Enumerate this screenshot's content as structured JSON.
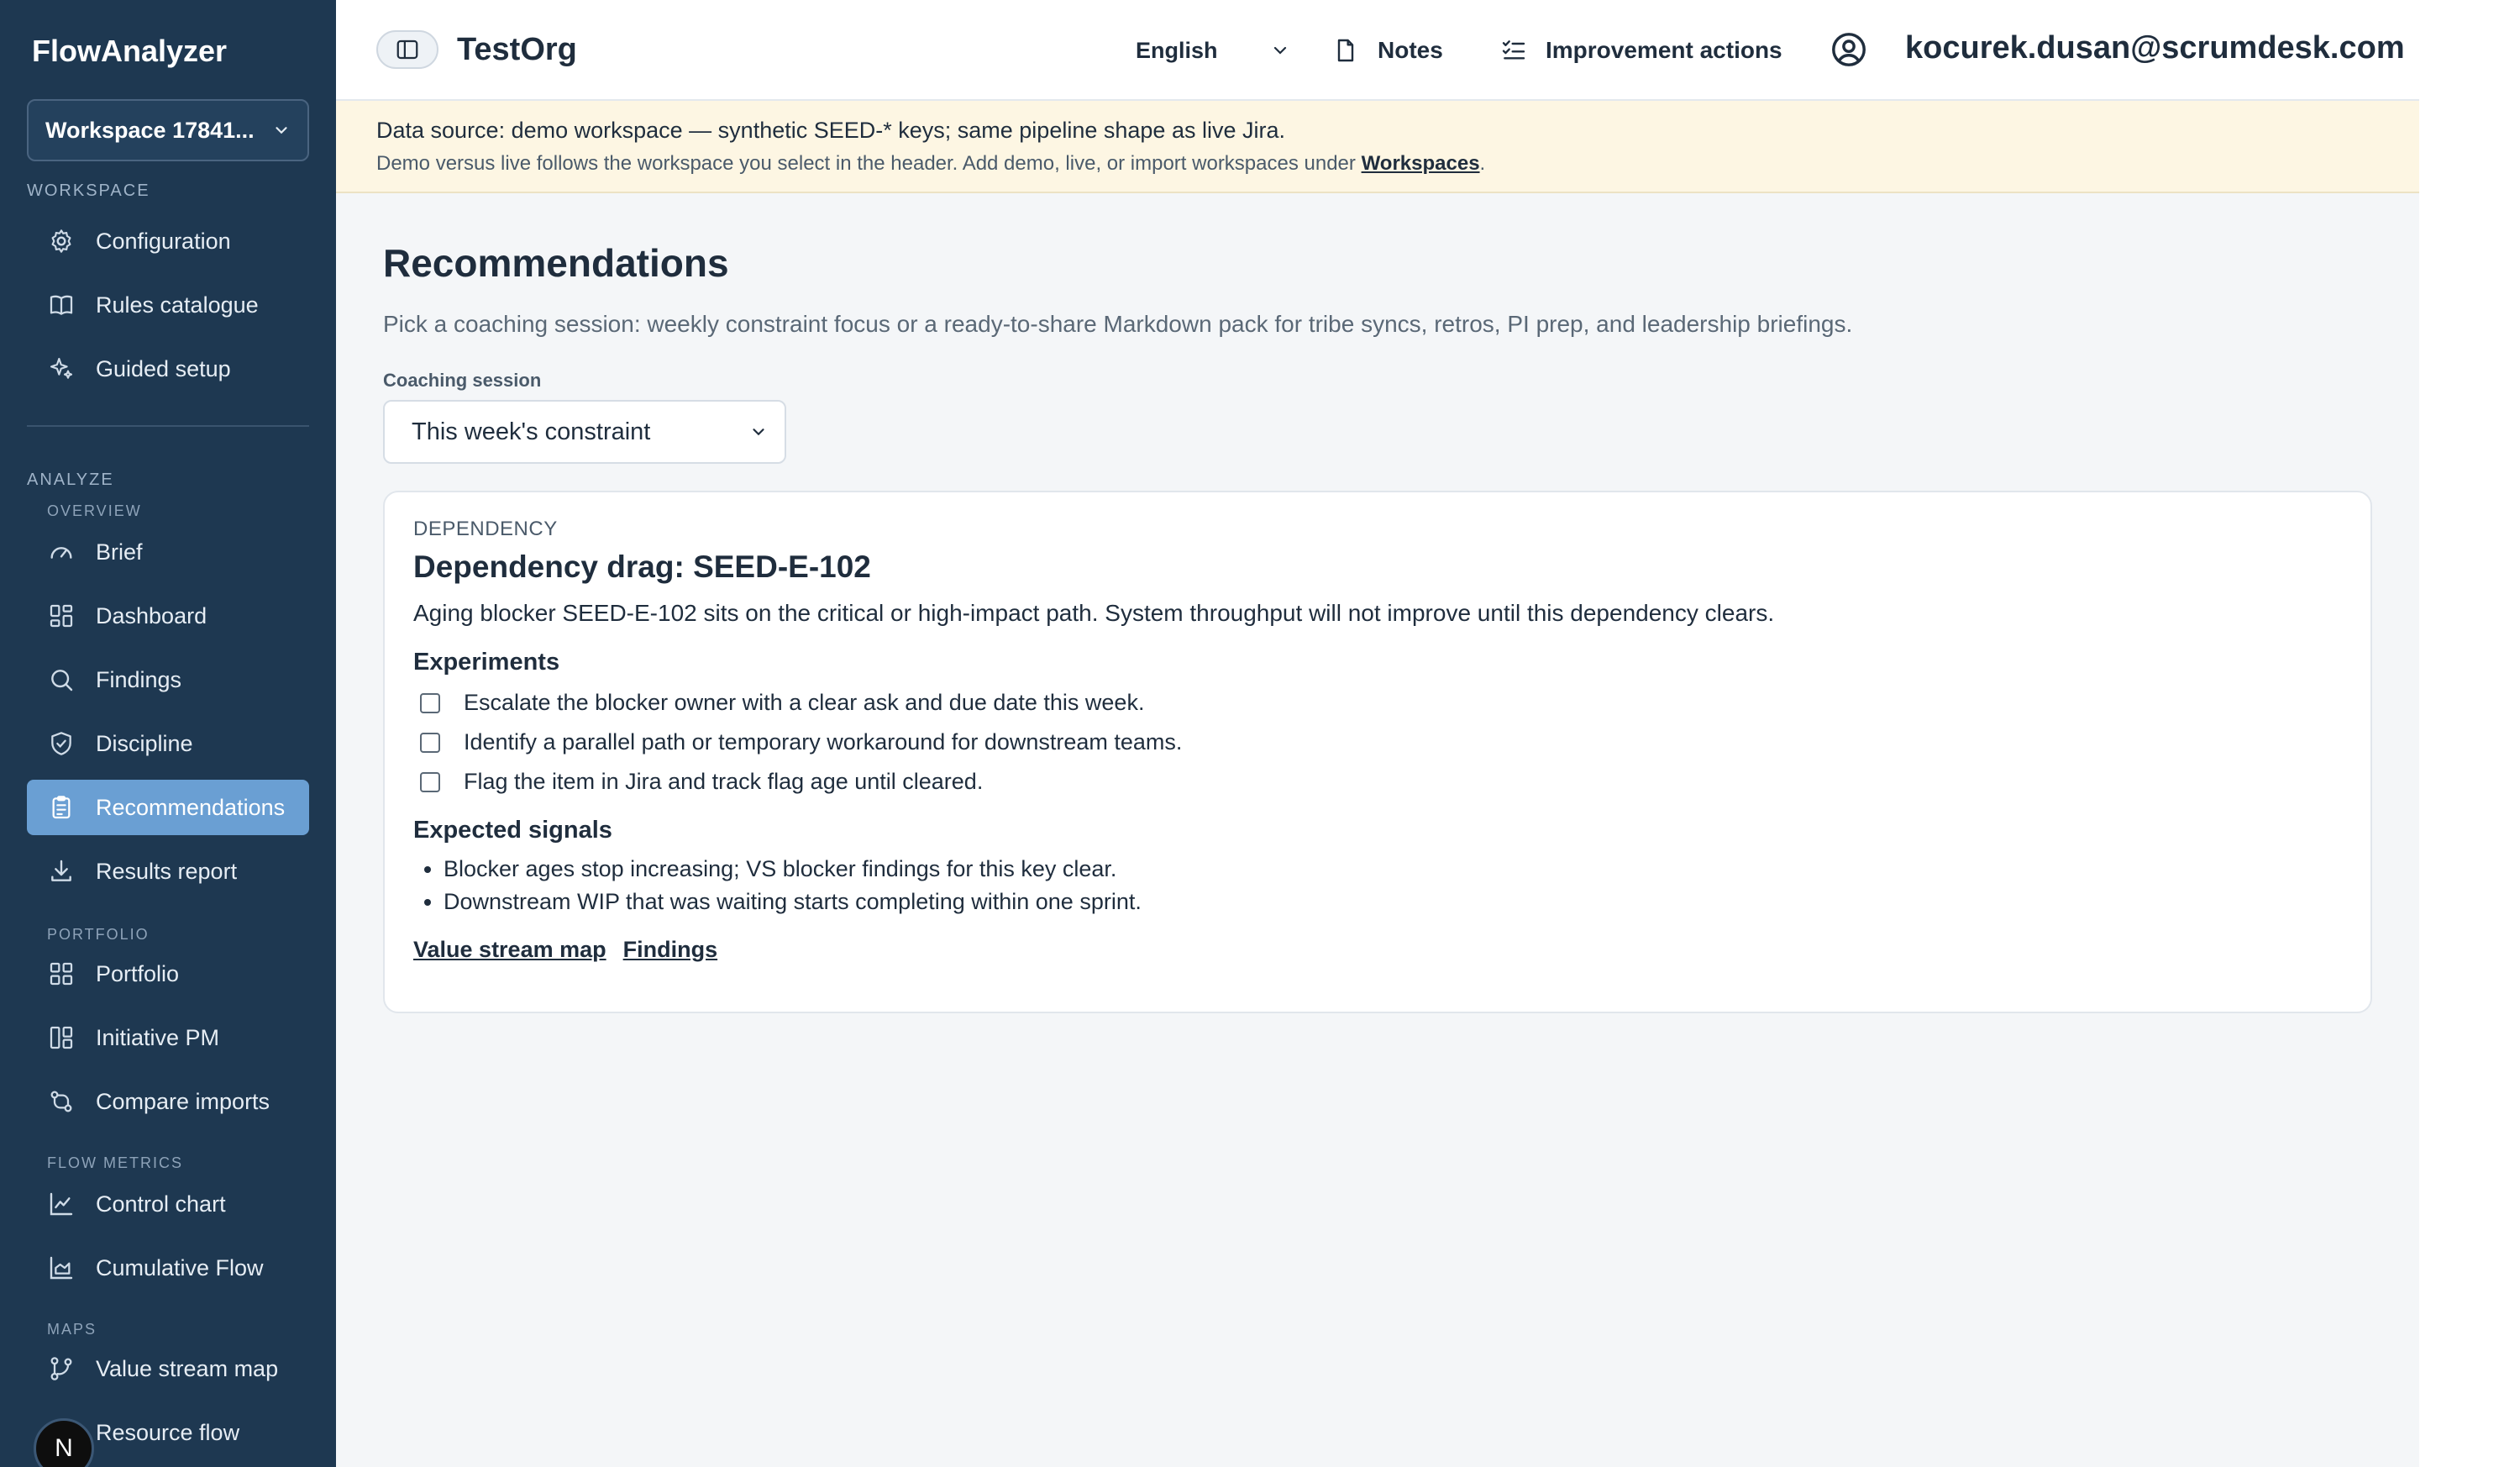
{
  "app": {
    "brand": "FlowAnalyzer"
  },
  "workspace": {
    "selected": "Workspace 17841..."
  },
  "sidebar": {
    "sections": {
      "workspace": "WORKSPACE",
      "analyze": "ANALYZE",
      "overview": "OVERVIEW",
      "portfolio": "PORTFOLIO",
      "flow_metrics": "FLOW METRICS",
      "maps": "MAPS"
    },
    "items": {
      "configuration": "Configuration",
      "rules_catalogue": "Rules catalogue",
      "guided_setup": "Guided setup",
      "brief": "Brief",
      "dashboard": "Dashboard",
      "findings": "Findings",
      "discipline": "Discipline",
      "recommendations": "Recommendations",
      "results_report": "Results report",
      "portfolio": "Portfolio",
      "initiative_pm": "Initiative PM",
      "compare_imports": "Compare imports",
      "control_chart": "Control chart",
      "cumulative_flow": "Cumulative Flow",
      "value_stream_map": "Value stream map",
      "resource_flow": "Resource flow"
    },
    "avatar_letter": "N"
  },
  "header": {
    "org": "TestOrg",
    "language": "English",
    "notes": "Notes",
    "improvement_actions": "Improvement actions",
    "user_email": "kocurek.dusan@scrumdesk.com"
  },
  "banner": {
    "line1": "Data source: demo workspace — synthetic SEED-* keys; same pipeline shape as live Jira.",
    "line2_prefix": "Demo versus live follows the workspace you select in the header. Add demo, live, or import workspaces under ",
    "line2_link": "Workspaces",
    "line2_suffix": "."
  },
  "page": {
    "title": "Recommendations",
    "description": "Pick a coaching session: weekly constraint focus or a ready-to-share Markdown pack for tribe syncs, retros, PI prep, and leadership briefings.",
    "coaching_label": "Coaching session",
    "coaching_value": "This week's constraint"
  },
  "card": {
    "category": "DEPENDENCY",
    "title": "Dependency drag: SEED-E-102",
    "body": "Aging blocker SEED-E-102 sits on the critical or high-impact path. System throughput will not improve until this dependency clears.",
    "experiments_heading": "Experiments",
    "experiments": [
      "Escalate the blocker owner with a clear ask and due date this week.",
      "Identify a parallel path or temporary workaround for downstream teams.",
      "Flag the item in Jira and track flag age until cleared."
    ],
    "signals_heading": "Expected signals",
    "signals": [
      "Blocker ages stop increasing; VS blocker findings for this key clear.",
      "Downstream WIP that was waiting starts completing within one sprint."
    ],
    "links": {
      "value_stream_map": "Value stream map",
      "findings": "Findings"
    }
  },
  "colors": {
    "sidebar_bg": "#1e3851",
    "active_item": "#6a9fd3",
    "banner_bg": "#fdf6e3"
  }
}
